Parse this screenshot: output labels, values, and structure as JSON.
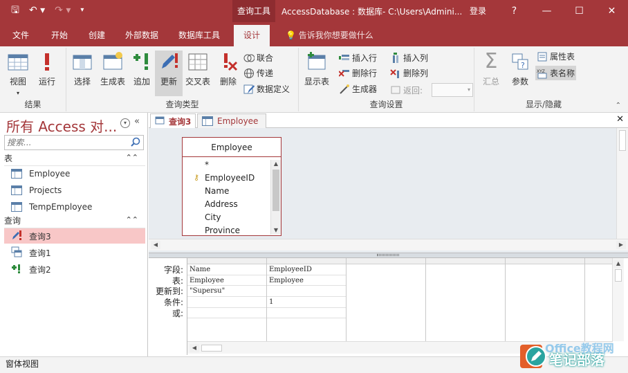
{
  "titlebar": {
    "context_tab": "查询工具",
    "window_title": "AccessDatabase : 数据库- C:\\Users\\Admini...",
    "signin": "登录",
    "help": "?",
    "min": "—",
    "max": "☐",
    "close": "✕"
  },
  "tabs": {
    "file": "文件",
    "home": "开始",
    "create": "创建",
    "external": "外部数据",
    "dbtools": "数据库工具",
    "design": "设计",
    "tellme": "告诉我你想要做什么"
  },
  "ribbon": {
    "results_group": "结果",
    "view": "视图",
    "run": "运行",
    "querytype_group": "查询类型",
    "select": "选择",
    "maketable": "生成表",
    "append": "追加",
    "update": "更新",
    "crosstab": "交叉表",
    "delete": "删除",
    "union": "联合",
    "passthrough": "传递",
    "datadef": "数据定义",
    "setup_group": "查询设置",
    "showtable": "显示表",
    "insertrows": "插入行",
    "deleterows": "删除行",
    "builder": "生成器",
    "insertcols": "插入列",
    "deletecols": "删除列",
    "return": "返回:",
    "showhide_group": "显示/隐藏",
    "totals": "汇总",
    "params": "参数",
    "propsheet": "属性表",
    "tablenames": "表名称"
  },
  "nav": {
    "title": "所有 Access 对...",
    "search_placeholder": "搜索...",
    "section_tables": "表",
    "tables": [
      "Employee",
      "Projects",
      "TempEmployee"
    ],
    "section_queries": "查询",
    "queries": [
      "查询3",
      "查询1",
      "查询2"
    ]
  },
  "doc": {
    "tab_query": "查询3",
    "tab_employee": "Employee",
    "table_title": "Employee",
    "fields": [
      "*",
      "EmployeeID",
      "Name",
      "Address",
      "City",
      "Province"
    ]
  },
  "grid": {
    "row_labels": [
      "字段:",
      "表:",
      "更新到:",
      "条件:",
      "或:"
    ],
    "col1": [
      "Name",
      "Employee",
      "\"Supersu\"",
      "",
      ""
    ],
    "col2": [
      "EmployeeID",
      "Employee",
      "",
      "1",
      ""
    ]
  },
  "status": "窗体视图",
  "watermark": {
    "text": "笔记部落",
    "brand": "Office教程网"
  },
  "colors": {
    "accent": "#a4373a",
    "ribbon": "#f3f3f3",
    "selection": "#f8c7c7"
  }
}
